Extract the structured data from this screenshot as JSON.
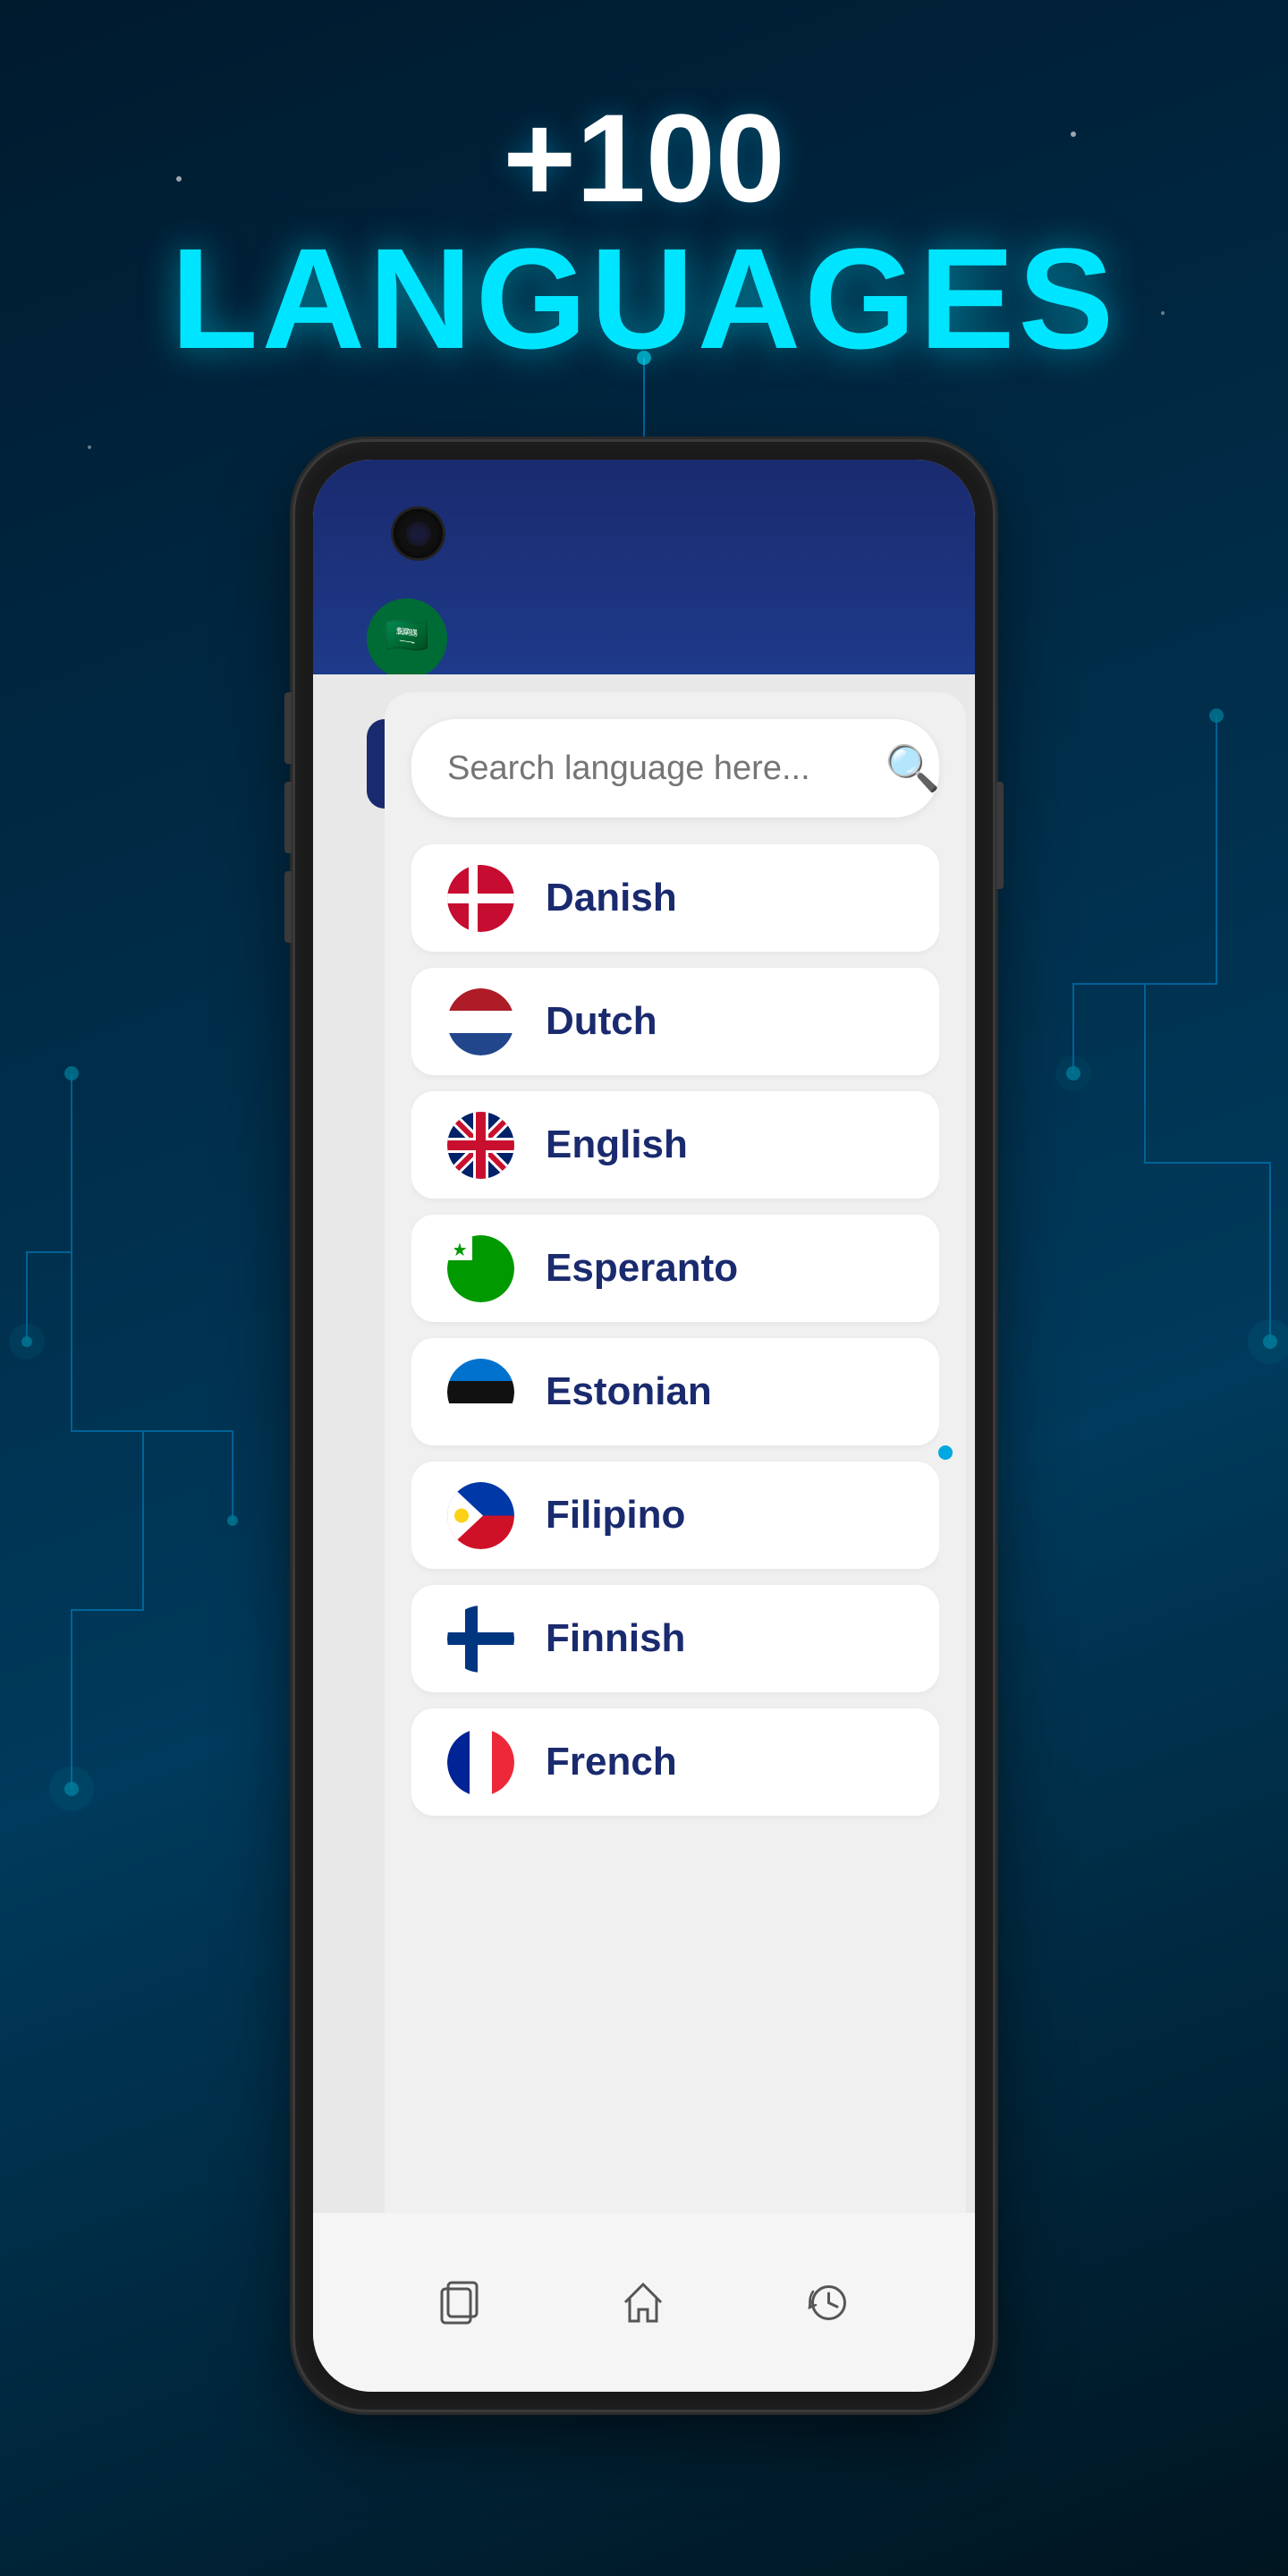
{
  "header": {
    "count": "+100",
    "title": "LANGUAGES"
  },
  "search": {
    "placeholder": "Search language here..."
  },
  "languages": [
    {
      "name": "Danish",
      "flag": "danish",
      "emoji": "🇩🇰"
    },
    {
      "name": "Dutch",
      "flag": "dutch",
      "emoji": "🇳🇱"
    },
    {
      "name": "English",
      "flag": "english",
      "emoji": "🇬🇧"
    },
    {
      "name": "Esperanto",
      "flag": "esperanto",
      "emoji": "🟢"
    },
    {
      "name": "Estonian",
      "flag": "estonian",
      "emoji": "🇪🇪"
    },
    {
      "name": "Filipino",
      "flag": "filipino",
      "emoji": "🇵🇭"
    },
    {
      "name": "Finnish",
      "flag": "finnish",
      "emoji": "🇫🇮"
    },
    {
      "name": "French",
      "flag": "french",
      "emoji": "🇫🇷"
    }
  ],
  "bottom_nav": {
    "icons": [
      "copy",
      "home",
      "history"
    ]
  }
}
